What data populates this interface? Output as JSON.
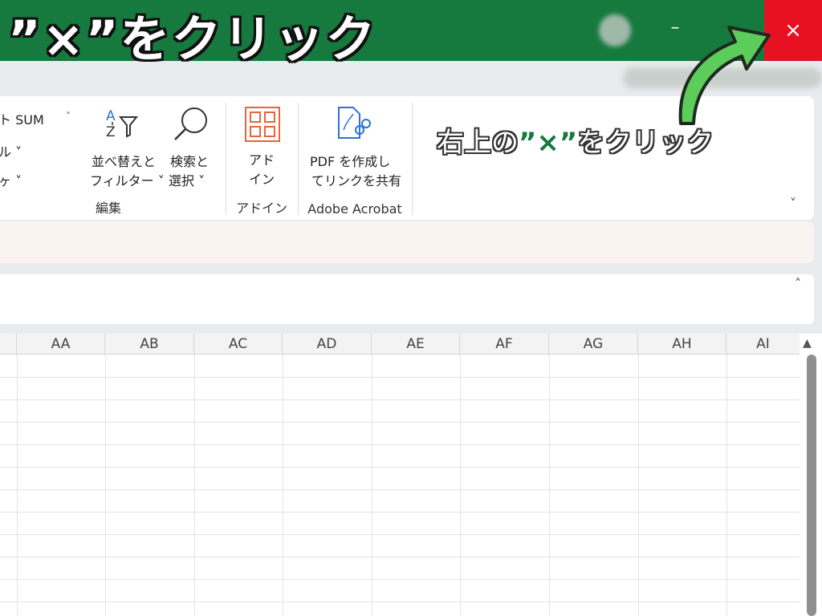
{
  "titlebar": {
    "banner": "”×”をクリック",
    "minimize_label": "–",
    "close_label": "×"
  },
  "ribbon": {
    "autosum": "ト SUM",
    "autosum_chev": "˅",
    "fill_partial": "ル ˅",
    "clear_partial": "ヶ ˅",
    "sort_filter": {
      "line1": "並べ替えと",
      "line2": "フィルター ˅"
    },
    "find_select": {
      "line1": "検索と",
      "line2": "選択 ˅"
    },
    "editing_group": "編集",
    "addin": {
      "line1": "アド",
      "line2": "イン",
      "group": "アドイン"
    },
    "pdf": {
      "line1": "PDF を作成し",
      "line2": "てリンクを共有",
      "group": "Adobe Acrobat"
    },
    "expand_label": "˅"
  },
  "annotation": {
    "prefix": "右上の",
    "mark": "”×”",
    "suffix": "をクリック"
  },
  "formula": {
    "collapse_label": "˄"
  },
  "grid": {
    "columns": [
      "AA",
      "AB",
      "AC",
      "AD",
      "AE",
      "AF",
      "AG",
      "AH",
      "AI"
    ],
    "scroll_up": "▲"
  },
  "colors": {
    "titlebar": "#167a3f",
    "close": "#e81123",
    "arrow": "#5ccc5a",
    "addin_icon": "#e8643c",
    "pdf_icon": "#2a72d8"
  }
}
